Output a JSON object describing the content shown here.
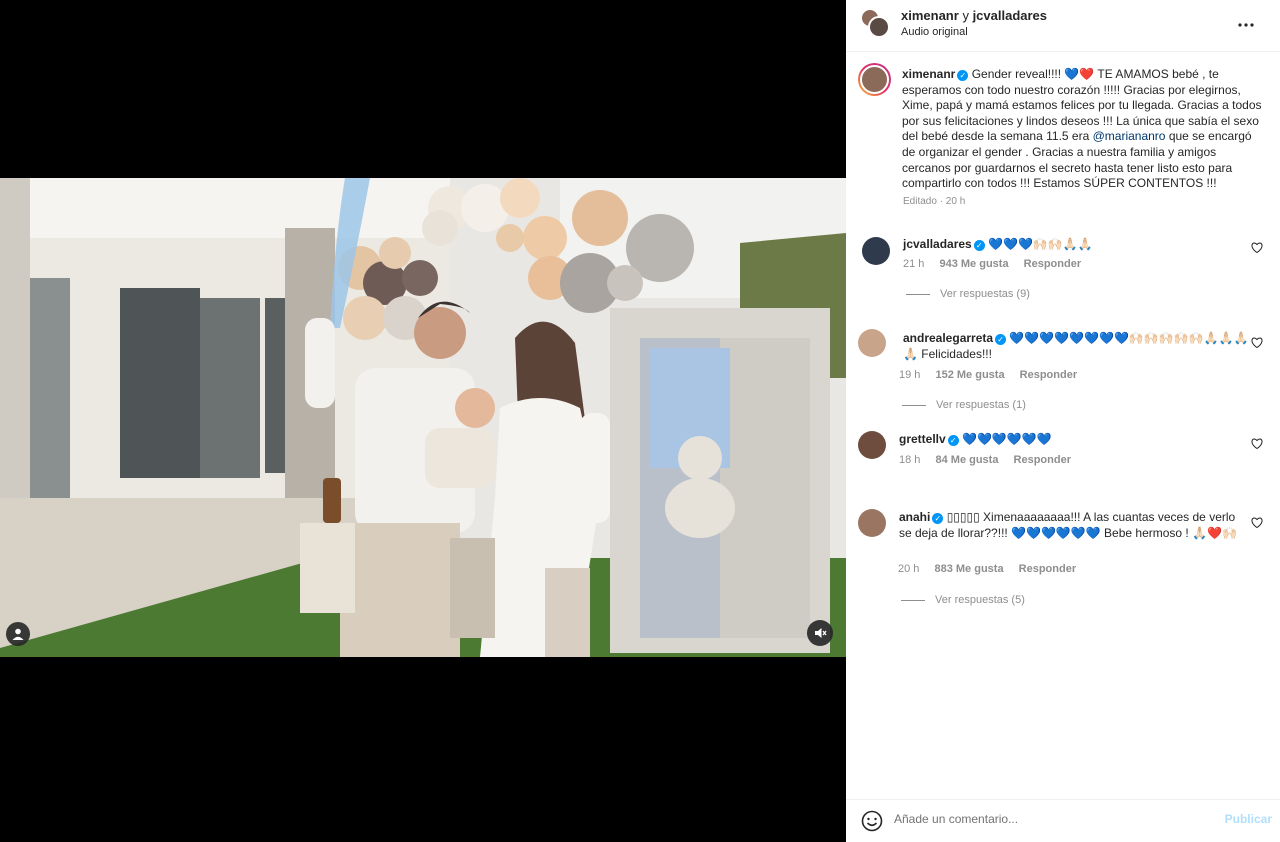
{
  "header": {
    "user1": "ximenanr",
    "join": "y",
    "user2": "jcvalladares",
    "subtitle": "Audio original"
  },
  "post": {
    "username": "ximenanr",
    "caption_before": "Gender reveal!!!! ",
    "caption_emoji1": "💙❤️",
    "caption_middle": " TE AMAMOS bebé , te esperamos con todo nuestro corazón !!!!! Gracias por elegirnos, Xime, papá y mamá estamos felices por tu llegada. Gracias a todos por sus felicitaciones y lindos deseos !!! La única que sabía el sexo del bebé desde la semana 11.5 era ",
    "caption_mention": "@mariananro",
    "caption_after": " que se encargó de organizar el gender . Gracias a nuestra familia y amigos cercanos por guardarnos el secreto hasta tener listo esto para compartirlo con todos !!! Estamos SÚPER CONTENTOS !!!",
    "meta": "Editado · 20 h"
  },
  "comments": [
    {
      "username": "jcvalladares",
      "text": "💙💙💙🙌🏻🙌🏻🙏🏻🙏🏻",
      "time": "21 h",
      "likes": "943 Me gusta",
      "reply": "Responder",
      "replies": "Ver respuestas (9)"
    },
    {
      "username": "andrealegarreta",
      "text": "💙💙💙💙💙💙💙💙🙌🏻🙌🏻🙌🏻🙌🏻🙌🏻🙏🏻🙏🏻🙏🏻🙏🏻 Felicidades!!!",
      "time": "19 h",
      "likes": "152 Me gusta",
      "reply": "Responder",
      "replies": "Ver respuestas (1)"
    },
    {
      "username": "grettellv",
      "text": "💙💙💙💙💙💙",
      "time": "18 h",
      "likes": "84 Me gusta",
      "reply": "Responder",
      "replies": ""
    },
    {
      "username": "anahi",
      "text": "▯▯▯▯▯ Ximenaaaaaaaa!!! A las cuantas veces de verlo se deja de llorar??!!! 💙💙💙💙💙💙 Bebe hermoso ! 🙏🏻❤️🙌🏻",
      "time": "20 h",
      "likes": "883 Me gusta",
      "reply": "Responder",
      "replies": "Ver respuestas (5)"
    }
  ],
  "footer": {
    "placeholder": "Añade un comentario...",
    "publish": "Publicar"
  },
  "colors": {
    "accent": "#0095f6",
    "publish_disabled": "#b2dffc",
    "meta": "#8e8e8e"
  },
  "icons": [
    "more-icon",
    "verified-icon",
    "heart-icon",
    "emoji-icon",
    "user-tag-icon",
    "muted-icon"
  ]
}
